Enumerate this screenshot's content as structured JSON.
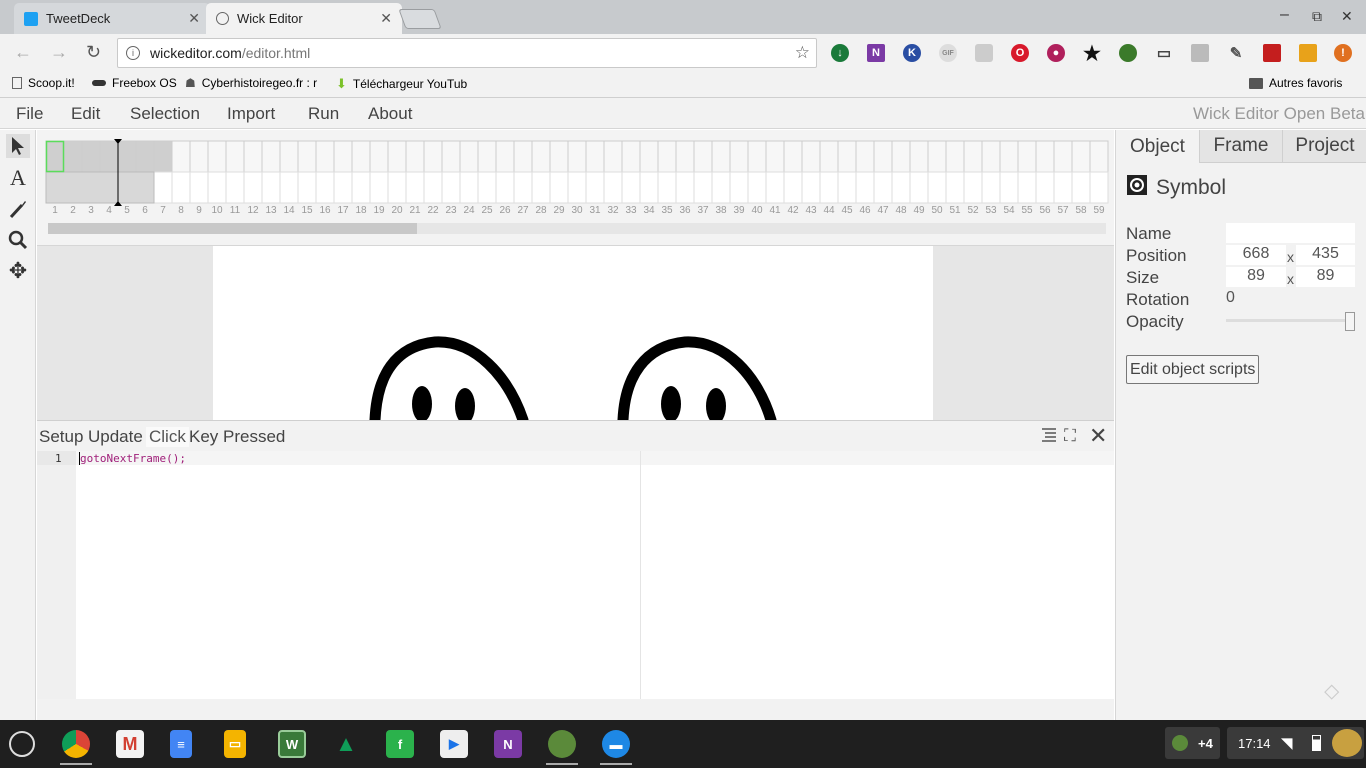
{
  "browser": {
    "tabs": [
      {
        "label": "TweetDeck",
        "active": false
      },
      {
        "label": "Wick Editor",
        "active": true
      }
    ],
    "url_host": "wickeditor.com",
    "url_path": "/editor.html",
    "bookmarks": [
      "Scoop.it!",
      "Freebox OS",
      "Cyberhistoiregeo.fr : r",
      "Téléchargeur YouTub"
    ],
    "other_bookmarks": "Autres favoris"
  },
  "app": {
    "menu": [
      "File",
      "Edit",
      "Selection",
      "Import",
      "Run",
      "About"
    ],
    "title": "Wick Editor Open Beta",
    "frame_numbers": [
      "1",
      "2",
      "3",
      "4",
      "5",
      "6",
      "7",
      "8",
      "9",
      "10",
      "11",
      "12",
      "13",
      "14",
      "15",
      "16",
      "17",
      "18",
      "19",
      "20",
      "21",
      "22",
      "23",
      "24",
      "25",
      "26",
      "27",
      "28",
      "29",
      "30",
      "31",
      "32",
      "33",
      "34",
      "35",
      "36",
      "37",
      "38",
      "39",
      "40",
      "41",
      "42",
      "43",
      "44",
      "45",
      "46",
      "47",
      "48",
      "49",
      "50",
      "51",
      "52",
      "53",
      "54",
      "55",
      "56",
      "57",
      "58",
      "59"
    ],
    "script_tabs": [
      "Setup",
      "Update",
      "Click",
      "Key Pressed"
    ],
    "active_script_tab": "Click",
    "code_line_number": "1",
    "code_text": "gotoNextFrame();",
    "panel_tabs": [
      "Object",
      "Frame",
      "Project"
    ],
    "inspector": {
      "heading": "Symbol",
      "name_label": "Name",
      "name_value": "",
      "position_label": "Position",
      "pos_x": "668",
      "pos_y": "435",
      "size_label": "Size",
      "size_w": "89",
      "size_h": "89",
      "times": "x",
      "rotation_label": "Rotation",
      "rotation_value": "0",
      "opacity_label": "Opacity",
      "opacity_value": 1.0,
      "edit_scripts_label": "Edit object scripts"
    }
  },
  "system": {
    "notifications": "+4",
    "time": "17:14"
  },
  "colors": {
    "frame_selected_outline": "#5bdc5b",
    "code_function": "#a0207a"
  }
}
